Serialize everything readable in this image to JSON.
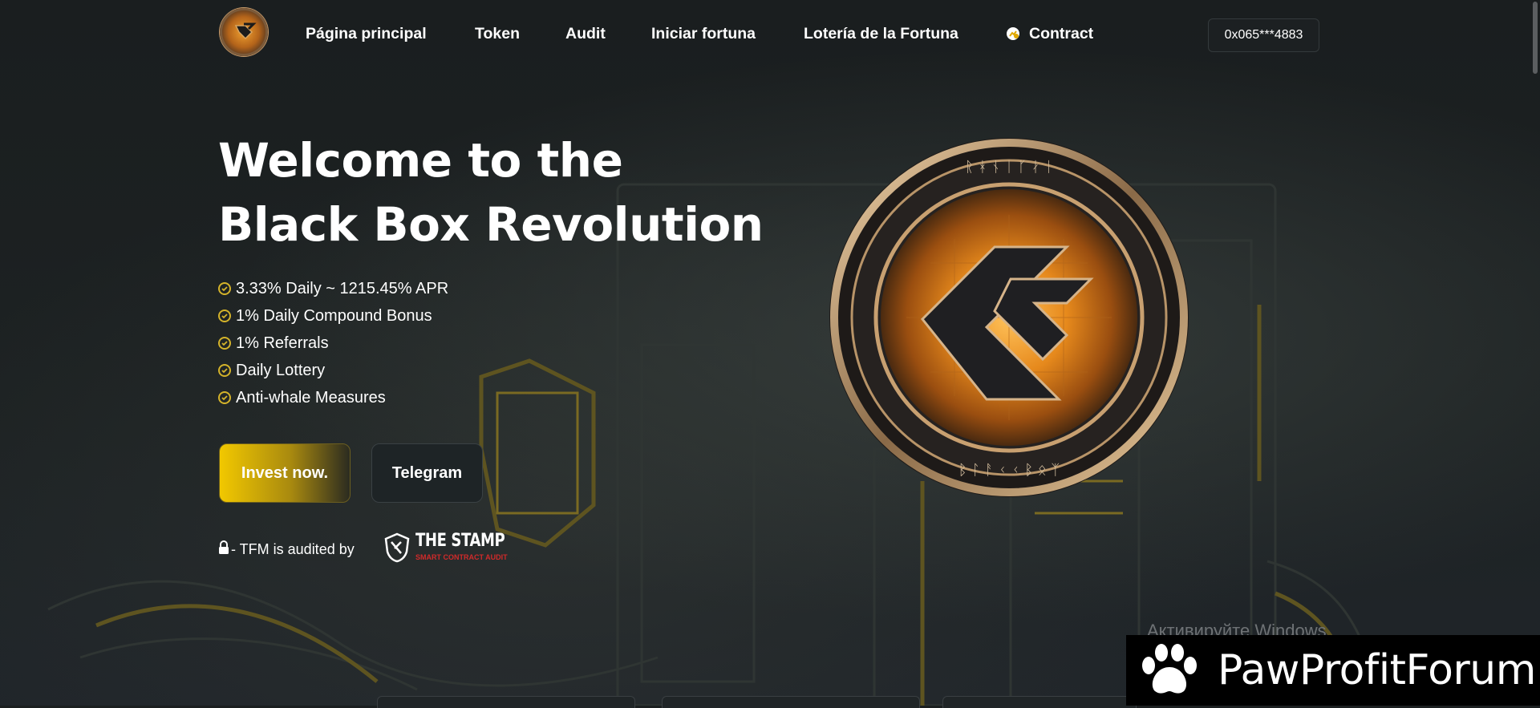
{
  "nav": {
    "logo_icon": "tfm-logo-icon",
    "links": [
      {
        "label": "Página principal"
      },
      {
        "label": "Token"
      },
      {
        "label": "Audit"
      },
      {
        "label": "Iniciar fortuna"
      },
      {
        "label": "Lotería de la Fortuna"
      },
      {
        "label": "Contract",
        "icon": "contract-icon"
      }
    ],
    "wallet_address": "0x065***4883"
  },
  "hero": {
    "title_line1": "Welcome to the",
    "title_line2": "Black Box Revolution",
    "features": [
      "3.33% Daily ~ 1215.45% APR",
      "1% Daily Compound Bonus",
      "1% Referrals",
      "Daily Lottery",
      "Anti-whale Measures"
    ],
    "invest_button": "Invest now.",
    "telegram_button": "Telegram",
    "audit_text": "- TFM is audited by",
    "stamp_title": "THE STAMP",
    "stamp_subtitle": "SMART CONTRACT AUDIT"
  },
  "overlay": {
    "windows_watermark": "Активируйте Windows",
    "banner_text": "PawProfitForum"
  },
  "colors": {
    "accent_gold": "#f2c800",
    "check_gold": "#d4b32a",
    "background": "#1b1f20",
    "stamp_red": "#d02a2a"
  }
}
